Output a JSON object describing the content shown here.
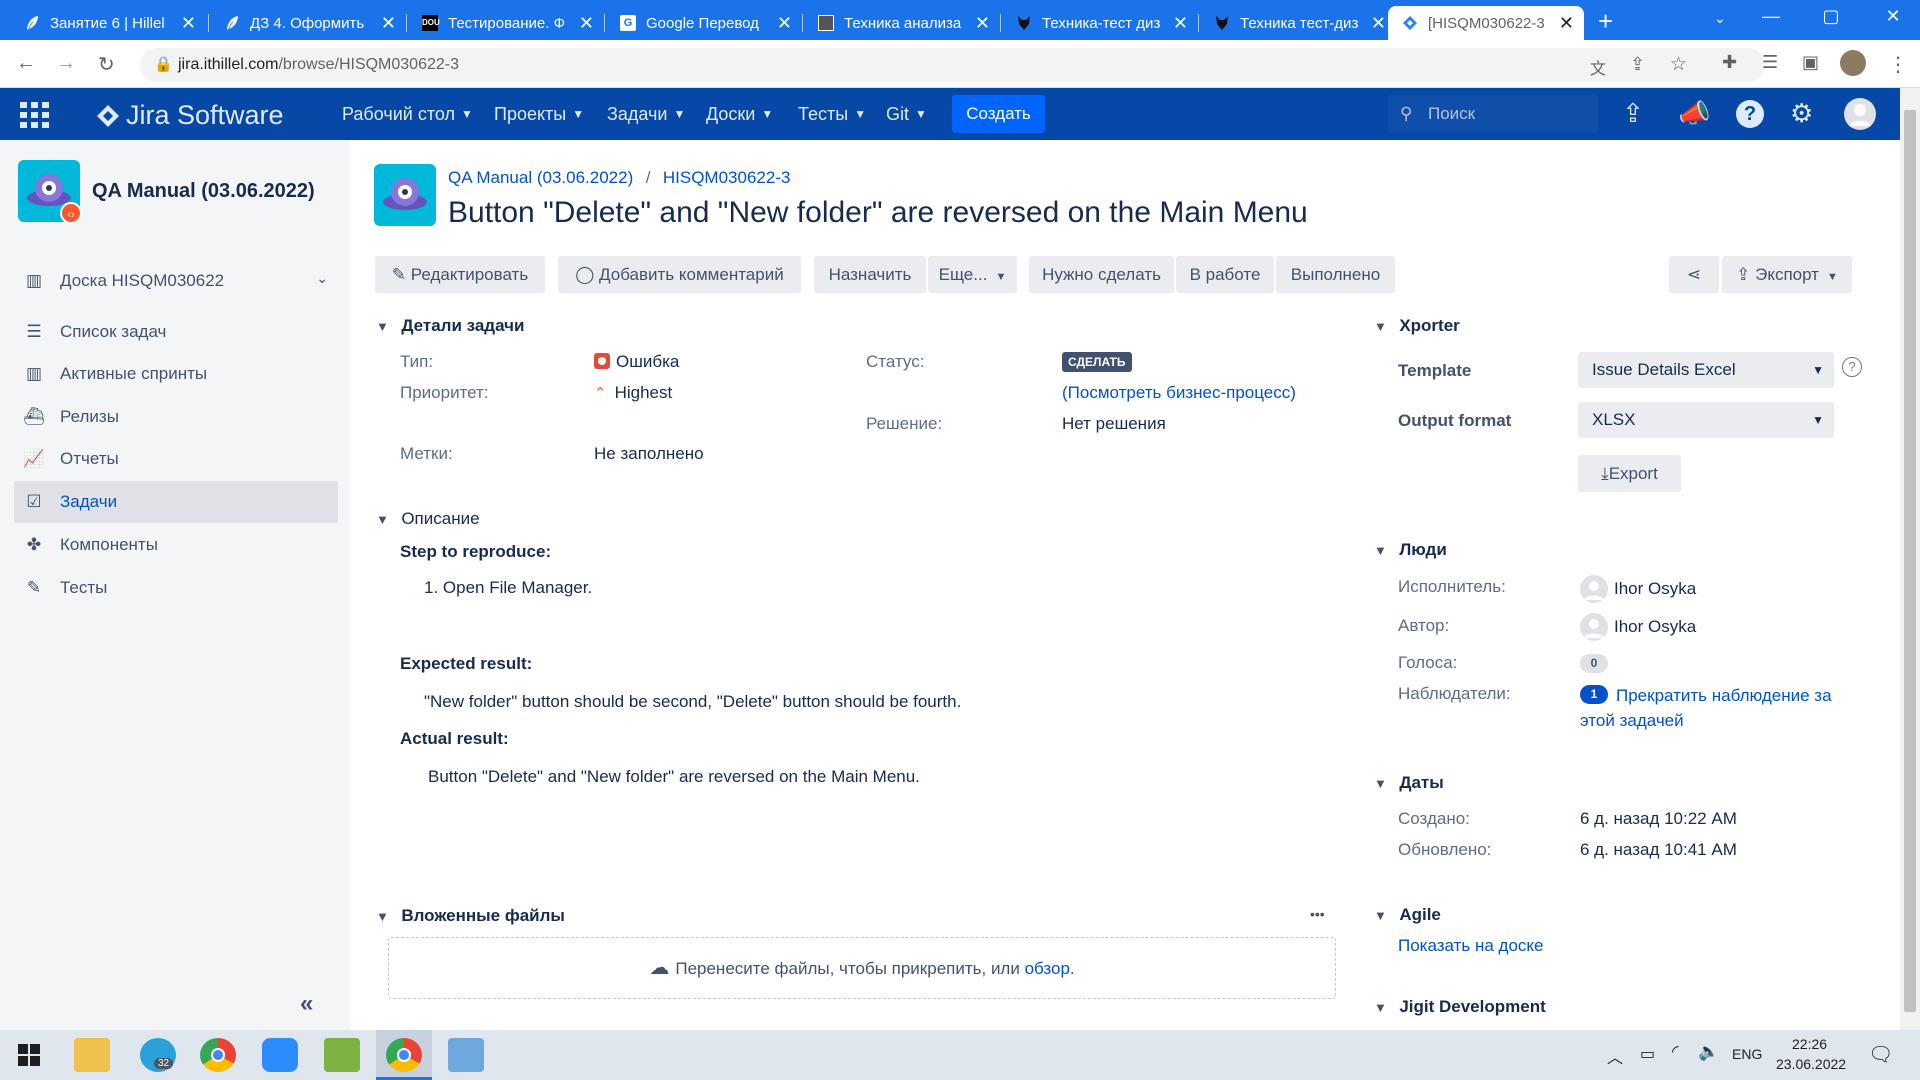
{
  "browser": {
    "tabs": [
      {
        "title": "Занятие 6 | Hillel",
        "favicon": "feather-icon"
      },
      {
        "title": "ДЗ 4. Оформить",
        "favicon": "feather-icon"
      },
      {
        "title": "Тестирование. Ф",
        "favicon": "dou-logo"
      },
      {
        "title": "Google Перевод",
        "favicon": "translate-icon"
      },
      {
        "title": "Техника анализа",
        "favicon": "image-icon"
      },
      {
        "title": "Техника-тест диз",
        "favicon": "fox-icon"
      },
      {
        "title": "Техника тест-диз",
        "favicon": "fox-icon"
      },
      {
        "title": "[HISQM030622-3",
        "favicon": "jira-icon",
        "active": true
      }
    ],
    "new_tab": "+",
    "url_host": "jira.ithillel.com",
    "url_path": "/browse/HISQM030622-3"
  },
  "header": {
    "product": "Jira Software",
    "nav": [
      "Рабочий стол",
      "Проекты",
      "Задачи",
      "Доски",
      "Тесты",
      "Git"
    ],
    "create": "Создать",
    "search_placeholder": "Поиск"
  },
  "sidebar": {
    "project": "QA Manual (03.06.2022)",
    "board": "Доска HISQM030622",
    "items": [
      "Список задач",
      "Активные спринты",
      "Релизы",
      "Отчеты",
      "Задачи",
      "Компоненты",
      "Тесты"
    ],
    "collapse": "«"
  },
  "issue": {
    "breadcrumb_project": "QA Manual (03.06.2022)",
    "breadcrumb_sep": "/",
    "key": "HISQM030622-3",
    "title": "Button \"Delete\" and \"New folder\" are reversed on the Main Menu",
    "toolbar": {
      "edit": "Редактировать",
      "comment": "Добавить комментарий",
      "assign": "Назначить",
      "more": "Еще...",
      "todo": "Нужно сделать",
      "inprogress": "В работе",
      "done": "Выполнено",
      "export": "Экспорт"
    },
    "details": {
      "heading": "Детали задачи",
      "type_label": "Тип:",
      "type_value": "Ошибка",
      "priority_label": "Приоритет:",
      "priority_value": "Highest",
      "labels_label": "Метки:",
      "labels_value": "Не заполнено",
      "status_label": "Статус:",
      "status_value": "СДЕЛАТЬ",
      "workflow_link": "(Посмотреть бизнес-процесс)",
      "resolution_label": "Решение:",
      "resolution_value": "Нет решения"
    },
    "description": {
      "heading": "Описание",
      "steps_title": "Step to reproduce:",
      "step1": "1. Open File Manager.",
      "expected_title": "Expected result:",
      "expected": "\"New folder\" button should be second, \"Delete\" button should be fourth.",
      "actual_title": "Actual result:",
      "actual": "Button \"Delete\" and \"New folder\" are reversed on the Main Menu."
    },
    "attachments": {
      "heading": "Вложенные файлы",
      "more": "•••",
      "drop_text": "Перенесите файлы, чтобы прикрепить, или ",
      "browse_link": "обзор."
    }
  },
  "right": {
    "xporter": {
      "heading": "Xporter",
      "template_label": "Template",
      "template_value": "Issue Details Excel",
      "format_label": "Output format",
      "format_value": "XLSX",
      "export": "Export",
      "help": "?"
    },
    "people": {
      "heading": "Люди",
      "assignee_label": "Исполнитель:",
      "assignee": "Ihor Osyka",
      "reporter_label": "Автор:",
      "reporter": "Ihor Osyka",
      "votes_label": "Голоса:",
      "votes": "0",
      "watchers_label": "Наблюдатели:",
      "watchers": "1",
      "watch_link": "Прекратить наблюдение за этой задачей"
    },
    "dates": {
      "heading": "Даты",
      "created_label": "Создано:",
      "created": "6 д. назад 10:22 AM",
      "updated_label": "Обновлено:",
      "updated": "6 д. назад 10:41 AM"
    },
    "agile": {
      "heading": "Agile",
      "link": "Показать на доске"
    },
    "jigit": {
      "heading": "Jigit Development"
    }
  },
  "taskbar": {
    "telegram_badge": "32",
    "lang": "ENG",
    "time": "22:26",
    "date": "23.06.2022"
  },
  "colors": {
    "chrome_blue": "#1a73e8",
    "jira_header": "#0747a6",
    "create_button": "#0065ff",
    "link": "#0052cc",
    "bug_red": "#e5493a",
    "status_dark": "#42526e"
  }
}
